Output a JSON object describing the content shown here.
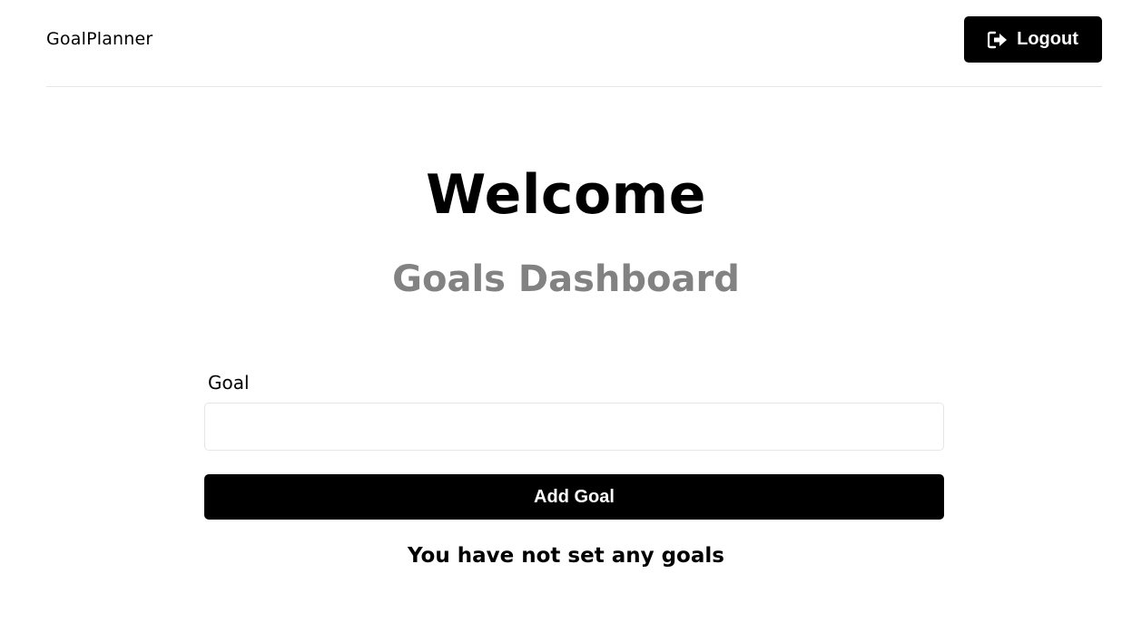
{
  "header": {
    "brand": "GoalPlanner",
    "logout_label": "Logout",
    "logout_icon": "sign-out-icon"
  },
  "main": {
    "welcome": "Welcome",
    "subtitle": "Goals Dashboard"
  },
  "form": {
    "goal_label": "Goal",
    "goal_value": "",
    "add_button_label": "Add Goal"
  },
  "goals": {
    "empty_message": "You have not set any goals"
  },
  "colors": {
    "primary": "#000000",
    "subtitle": "#828282",
    "border": "#e6e6e6",
    "background": "#ffffff"
  }
}
